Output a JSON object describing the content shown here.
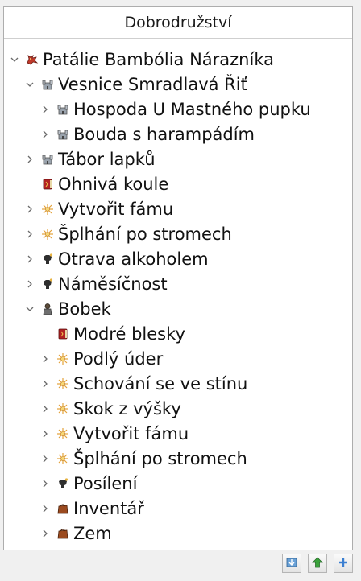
{
  "header": {
    "title": "Dobrodružství"
  },
  "tree": [
    {
      "label": "Patálie Bambólia Nárazníka",
      "depth": 0,
      "chevron": "down",
      "icon": "dragon-icon"
    },
    {
      "label": "Vesnice Smradlavá Řiť",
      "depth": 1,
      "chevron": "down",
      "icon": "castle-icon"
    },
    {
      "label": "Hospoda U Mastného pupku",
      "depth": 2,
      "chevron": "right",
      "icon": "castle-icon"
    },
    {
      "label": "Bouda s harampádím",
      "depth": 2,
      "chevron": "right",
      "icon": "castle-icon"
    },
    {
      "label": "Tábor lapků",
      "depth": 1,
      "chevron": "right",
      "icon": "castle-icon"
    },
    {
      "label": "Ohnivá koule",
      "depth": 1,
      "chevron": "none",
      "icon": "spellbook-icon"
    },
    {
      "label": "Vytvořit fámu",
      "depth": 1,
      "chevron": "right",
      "icon": "sparkle-icon"
    },
    {
      "label": "Šplhání po stromech",
      "depth": 1,
      "chevron": "right",
      "icon": "sparkle-icon"
    },
    {
      "label": "Otrava alkoholem",
      "depth": 1,
      "chevron": "right",
      "icon": "creature-icon"
    },
    {
      "label": "Náměsíčnost",
      "depth": 1,
      "chevron": "right",
      "icon": "creature-icon"
    },
    {
      "label": "Bobek",
      "depth": 1,
      "chevron": "down",
      "icon": "character-icon"
    },
    {
      "label": "Modré blesky",
      "depth": 2,
      "chevron": "none",
      "icon": "spellbook-icon"
    },
    {
      "label": "Podlý úder",
      "depth": 2,
      "chevron": "right",
      "icon": "sparkle-icon"
    },
    {
      "label": "Schování se ve stínu",
      "depth": 2,
      "chevron": "right",
      "icon": "sparkle-icon"
    },
    {
      "label": "Skok z výšky",
      "depth": 2,
      "chevron": "right",
      "icon": "sparkle-icon"
    },
    {
      "label": "Vytvořit fámu",
      "depth": 2,
      "chevron": "right",
      "icon": "sparkle-icon"
    },
    {
      "label": "Šplhání po stromech",
      "depth": 2,
      "chevron": "right",
      "icon": "sparkle-icon"
    },
    {
      "label": "Posílení",
      "depth": 2,
      "chevron": "right",
      "icon": "creature-icon"
    },
    {
      "label": "Inventář",
      "depth": 2,
      "chevron": "right",
      "icon": "bag-icon"
    },
    {
      "label": "Zem",
      "depth": 2,
      "chevron": "right",
      "icon": "bag-icon"
    }
  ],
  "toolbar": [
    {
      "icon": "import-icon"
    },
    {
      "icon": "move-up-icon"
    },
    {
      "icon": "add-icon"
    }
  ]
}
